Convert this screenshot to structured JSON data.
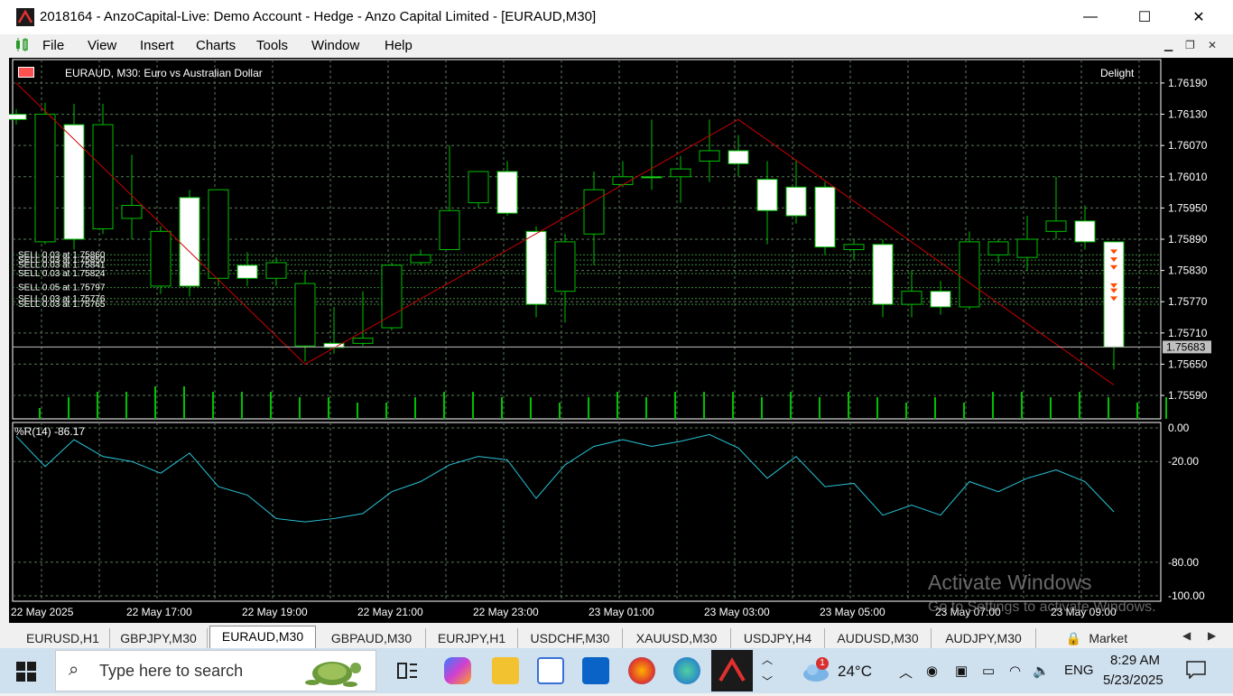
{
  "window": {
    "title": "2018164 - AnzoCapital-Live: Demo Account - Hedge - Anzo Capital Limited - [EURAUD,M30]",
    "minimize": "—",
    "maximize": "☐",
    "close": "✕"
  },
  "menu": [
    "File",
    "View",
    "Insert",
    "Charts",
    "Tools",
    "Window",
    "Help"
  ],
  "chart": {
    "title": "EURAUD, M30:  Euro vs Australian Dollar",
    "delight": "Delight",
    "current_price": "1.75683",
    "indicator_label": "%R(14) -86.17",
    "watermark_line1": "Activate Windows",
    "watermark_line2": "Go to Settings to activate Windows."
  },
  "chart_data": {
    "type": "candlestick",
    "symbol": "EURAUD",
    "timeframe": "M30",
    "price_ticks": [
      "1.76190",
      "1.76130",
      "1.76070",
      "1.76010",
      "1.75950",
      "1.75890",
      "1.75830",
      "1.75770",
      "1.75710",
      "1.75650",
      "1.75590"
    ],
    "wpr_ticks": [
      "0.00",
      "-20.00",
      "-80.00",
      "-100.00"
    ],
    "time_labels": [
      "22 May 2025",
      "22 May 17:00",
      "22 May 19:00",
      "22 May 21:00",
      "22 May 23:00",
      "23 May 01:00",
      "23 May 03:00",
      "23 May 05:00",
      "23 May 07:00",
      "23 May 09:00"
    ],
    "current_price": 1.75683,
    "candles": [
      {
        "o": 1.7613,
        "h": 1.7614,
        "l": 1.7611,
        "c": 1.7612
      },
      {
        "o": 1.75885,
        "h": 1.76152,
        "l": 1.7588,
        "c": 1.7613
      },
      {
        "o": 1.7611,
        "h": 1.7615,
        "l": 1.7587,
        "c": 1.7589
      },
      {
        "o": 1.7591,
        "h": 1.7615,
        "l": 1.759,
        "c": 1.7611
      },
      {
        "o": 1.7593,
        "h": 1.76052,
        "l": 1.7589,
        "c": 1.75955
      },
      {
        "o": 1.758,
        "h": 1.75915,
        "l": 1.75785,
        "c": 1.75905
      },
      {
        "o": 1.7597,
        "h": 1.75985,
        "l": 1.7578,
        "c": 1.758
      },
      {
        "o": 1.75815,
        "h": 1.75985,
        "l": 1.758,
        "c": 1.75985
      },
      {
        "o": 1.7584,
        "h": 1.75865,
        "l": 1.758,
        "c": 1.75815
      },
      {
        "o": 1.75815,
        "h": 1.75855,
        "l": 1.758,
        "c": 1.75845
      },
      {
        "o": 1.75685,
        "h": 1.7583,
        "l": 1.75655,
        "c": 1.75805
      },
      {
        "o": 1.7569,
        "h": 1.7576,
        "l": 1.7567,
        "c": 1.75682
      },
      {
        "o": 1.7569,
        "h": 1.7579,
        "l": 1.75685,
        "c": 1.757
      },
      {
        "o": 1.7572,
        "h": 1.75845,
        "l": 1.75715,
        "c": 1.7584
      },
      {
        "o": 1.75845,
        "h": 1.7587,
        "l": 1.7584,
        "c": 1.7586
      },
      {
        "o": 1.7587,
        "h": 1.7607,
        "l": 1.7587,
        "c": 1.75945
      },
      {
        "o": 1.7596,
        "h": 1.7601,
        "l": 1.7595,
        "c": 1.7602
      },
      {
        "o": 1.7602,
        "h": 1.7604,
        "l": 1.75935,
        "c": 1.7594
      },
      {
        "o": 1.75905,
        "h": 1.75915,
        "l": 1.7574,
        "c": 1.75765
      },
      {
        "o": 1.7579,
        "h": 1.759,
        "l": 1.7573,
        "c": 1.75885
      },
      {
        "o": 1.759,
        "h": 1.7602,
        "l": 1.7584,
        "c": 1.75985
      },
      {
        "o": 1.75995,
        "h": 1.7604,
        "l": 1.7599,
        "c": 1.7601
      },
      {
        "o": 1.7601,
        "h": 1.7612,
        "l": 1.75985,
        "c": 1.76008
      },
      {
        "o": 1.7601,
        "h": 1.7605,
        "l": 1.7596,
        "c": 1.76025
      },
      {
        "o": 1.7604,
        "h": 1.7612,
        "l": 1.76,
        "c": 1.7606
      },
      {
        "o": 1.7606,
        "h": 1.7609,
        "l": 1.7601,
        "c": 1.76035
      },
      {
        "o": 1.76005,
        "h": 1.7604,
        "l": 1.7588,
        "c": 1.75945
      },
      {
        "o": 1.7599,
        "h": 1.7604,
        "l": 1.7592,
        "c": 1.75935
      },
      {
        "o": 1.7599,
        "h": 1.76,
        "l": 1.7586,
        "c": 1.75875
      },
      {
        "o": 1.7587,
        "h": 1.7589,
        "l": 1.7585,
        "c": 1.7588
      },
      {
        "o": 1.7588,
        "h": 1.7589,
        "l": 1.7574,
        "c": 1.75765
      },
      {
        "o": 1.75765,
        "h": 1.7583,
        "l": 1.7574,
        "c": 1.7579
      },
      {
        "o": 1.7579,
        "h": 1.7581,
        "l": 1.75745,
        "c": 1.7576
      },
      {
        "o": 1.7576,
        "h": 1.75905,
        "l": 1.75755,
        "c": 1.75885
      },
      {
        "o": 1.7586,
        "h": 1.7589,
        "l": 1.75845,
        "c": 1.75885
      },
      {
        "o": 1.75855,
        "h": 1.75935,
        "l": 1.7583,
        "c": 1.7589
      },
      {
        "o": 1.75905,
        "h": 1.7601,
        "l": 1.7589,
        "c": 1.75925
      },
      {
        "o": 1.75925,
        "h": 1.75955,
        "l": 1.7587,
        "c": 1.75885
      },
      {
        "o": 1.75885,
        "h": 1.75885,
        "l": 1.7564,
        "c": 1.75683
      }
    ],
    "volumes": [
      2,
      4,
      5,
      5,
      6,
      6,
      5,
      5,
      5,
      4,
      4,
      3,
      3,
      4,
      5,
      5,
      4,
      4,
      3,
      4,
      5,
      4,
      5,
      5,
      5,
      4,
      5,
      4,
      5,
      4,
      3,
      4,
      3,
      5,
      5,
      4,
      5,
      4,
      3,
      4,
      5
    ],
    "zigzag": [
      {
        "i": 0,
        "p": 1.7619
      },
      {
        "i": 10,
        "p": 1.7565
      },
      {
        "i": 25,
        "p": 1.7612
      },
      {
        "i": 38,
        "p": 1.7561
      }
    ],
    "orders": [
      {
        "label": "SELL 0.03 at 1.75860",
        "p": 1.7586
      },
      {
        "label": "SELL 0.03 at 1.75850",
        "p": 1.7585
      },
      {
        "label": "SELL 0.03 at 1.75841",
        "p": 1.75841
      },
      {
        "label": "SELL 0.03 at 1.75824",
        "p": 1.75824
      },
      {
        "label": "SELL 0.05 at 1.75797",
        "p": 1.75797
      },
      {
        "label": "SELL 0.03 at 1.75776",
        "p": 1.75776
      },
      {
        "label": "SELL 0.03 at 1.75765",
        "p": 1.75765
      }
    ],
    "wpr": [
      -5,
      -23,
      -7,
      -17,
      -20,
      -27,
      -15,
      -35,
      -40,
      -54,
      -56,
      -54,
      -51,
      -38,
      -32,
      -22,
      -17,
      -19,
      -42,
      -22,
      -11,
      -7,
      -11,
      -8,
      -4,
      -12,
      -30,
      -17,
      -35,
      -33,
      -52,
      -46,
      -52,
      -32,
      -38,
      -30,
      -25,
      -32,
      -50
    ],
    "colors": {
      "background": "#000000",
      "bull_fill": "#000000",
      "bear_fill": "#ffffff",
      "wick": "#00c000",
      "grid": "#5a7a5a",
      "zigzag": "#cc0000",
      "wpr": "#28c6d8",
      "axis_text": "#ffffff"
    }
  },
  "tabs": [
    "EURUSD,H1",
    "GBPJPY,M30",
    "EURAUD,M30",
    "GBPAUD,M30",
    "EURJPY,H1",
    "USDCHF,M30",
    "XAUUSD,M30",
    "USDJPY,H4",
    "AUDUSD,M30",
    "AUDJPY,M30",
    "Market"
  ],
  "active_tab": "EURAUD,M30",
  "taskbar": {
    "search_placeholder": "Type here to search",
    "weather": "24°C",
    "weather_badge": "1",
    "language": "ENG",
    "time": "8:29 AM",
    "date": "5/23/2025"
  }
}
